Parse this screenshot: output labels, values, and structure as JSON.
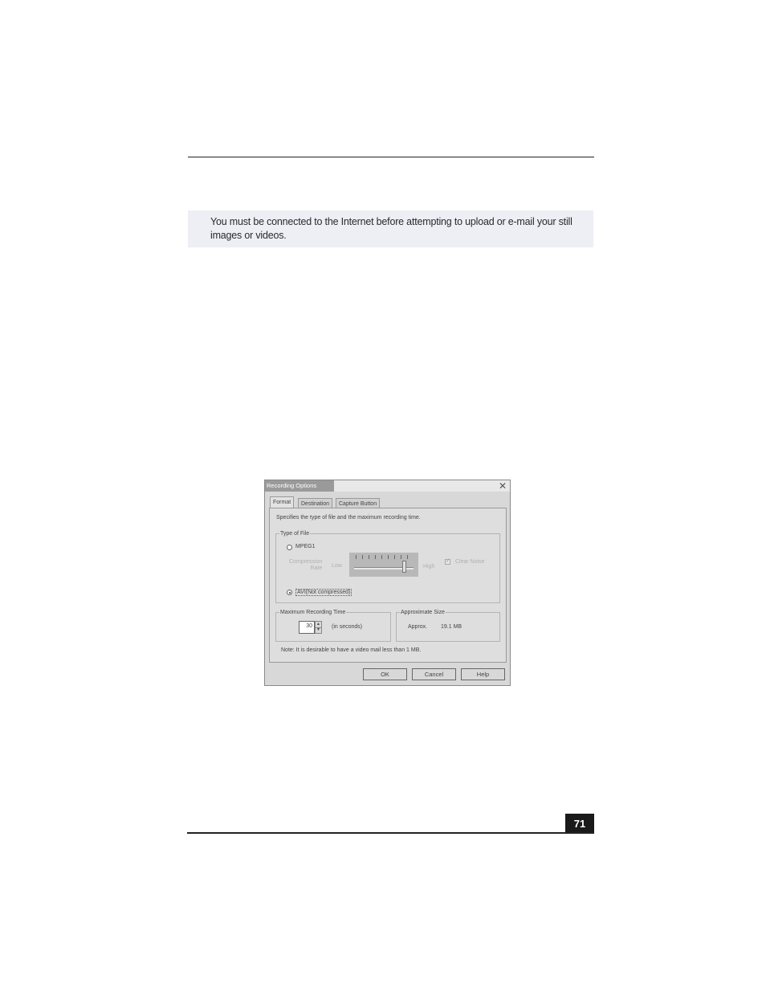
{
  "page": {
    "note_line1": "You must be connected to the Internet before attempting to upload or e-mail your still",
    "note_line2": "images or videos.",
    "page_number": "71"
  },
  "dialog": {
    "title": "Recording Options",
    "tabs": [
      "Format",
      "Destination",
      "Capture Button"
    ],
    "instruction": "Specifies the type of file and the maximum recording time.",
    "type_of_file": {
      "legend": "Type of File",
      "option_mpeg": "MPEG1",
      "compression_label_line1": "Compression",
      "compression_label_line2": "Rate",
      "low": "Low",
      "high": "High",
      "clear_noise": "Clear Noise",
      "option_avi": "AVI(Not compressed)",
      "selected": "AVI(Not compressed)"
    },
    "max_time": {
      "legend": "Maximum Recording Time",
      "value": "30",
      "unit": "(in seconds)"
    },
    "approx_size": {
      "legend": "Approximate Size",
      "label": "Approx.",
      "value": "19.1 MB"
    },
    "footnote": "Note: It is desirable to have a video mail less than 1 MB.",
    "buttons": {
      "ok": "OK",
      "cancel": "Cancel",
      "help": "Help"
    }
  }
}
